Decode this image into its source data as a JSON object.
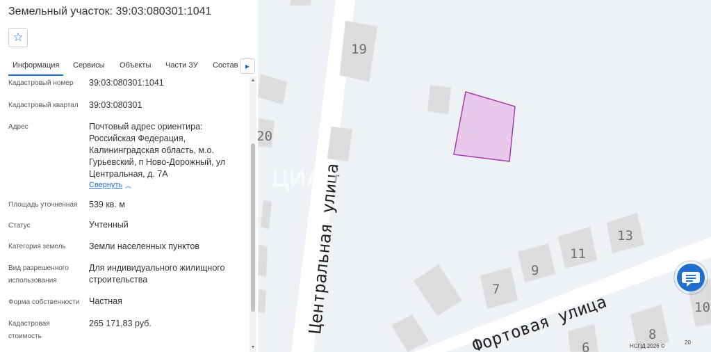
{
  "header": {
    "title": "Земельный участок: 39:03:080301:1041",
    "favorite_icon": "star-icon"
  },
  "tabs": [
    {
      "label": "Информация",
      "active": true
    },
    {
      "label": "Сервисы"
    },
    {
      "label": "Объекты"
    },
    {
      "label": "Части ЗУ"
    },
    {
      "label": "Состав"
    }
  ],
  "tabs_scroll_icon": "chevron-right-icon",
  "fields": [
    {
      "label": "Кадастровый номер",
      "value": "39:03:080301:1041"
    },
    {
      "label": "Кадастровый квартал",
      "value": "39:03:080301"
    },
    {
      "label": "Адрес",
      "value_lines": [
        "Почтовый адрес ориентира:",
        "Российская Федерация,",
        "Калининградская область, м.о.",
        "Гурьевский, п Ново-Дорожный, ул",
        "Центральная, д. 7А"
      ],
      "action": "Свернуть"
    },
    {
      "label": "Площадь уточненная",
      "value": "539 кв. м"
    },
    {
      "label": "Статус",
      "value": "Учтенный"
    },
    {
      "label": "Категория земель",
      "value": "Земли населенных пунктов"
    },
    {
      "label_lines": [
        "Вид разрешенного",
        "использования"
      ],
      "value_lines": [
        "Для индивидуального жилищного",
        "строительства"
      ]
    },
    {
      "label": "Форма собственности",
      "value": "Частная"
    },
    {
      "label_lines": [
        "Кадастровая",
        "стоимость"
      ],
      "value": "265 171,83 руб."
    }
  ],
  "map": {
    "streets": [
      "Центральная улица",
      "Фортовая улица"
    ],
    "house_numbers": [
      "19",
      "20",
      "13",
      "11",
      "9",
      "7",
      "8",
      "6",
      "10"
    ],
    "parcel_fill": "#e8c9ec",
    "parcel_stroke": "#a040a8",
    "watermark": "ЦИАН",
    "attribution": "НСПД 2026 ©",
    "scale_label": "20"
  },
  "chat_icon": "chat-icon"
}
